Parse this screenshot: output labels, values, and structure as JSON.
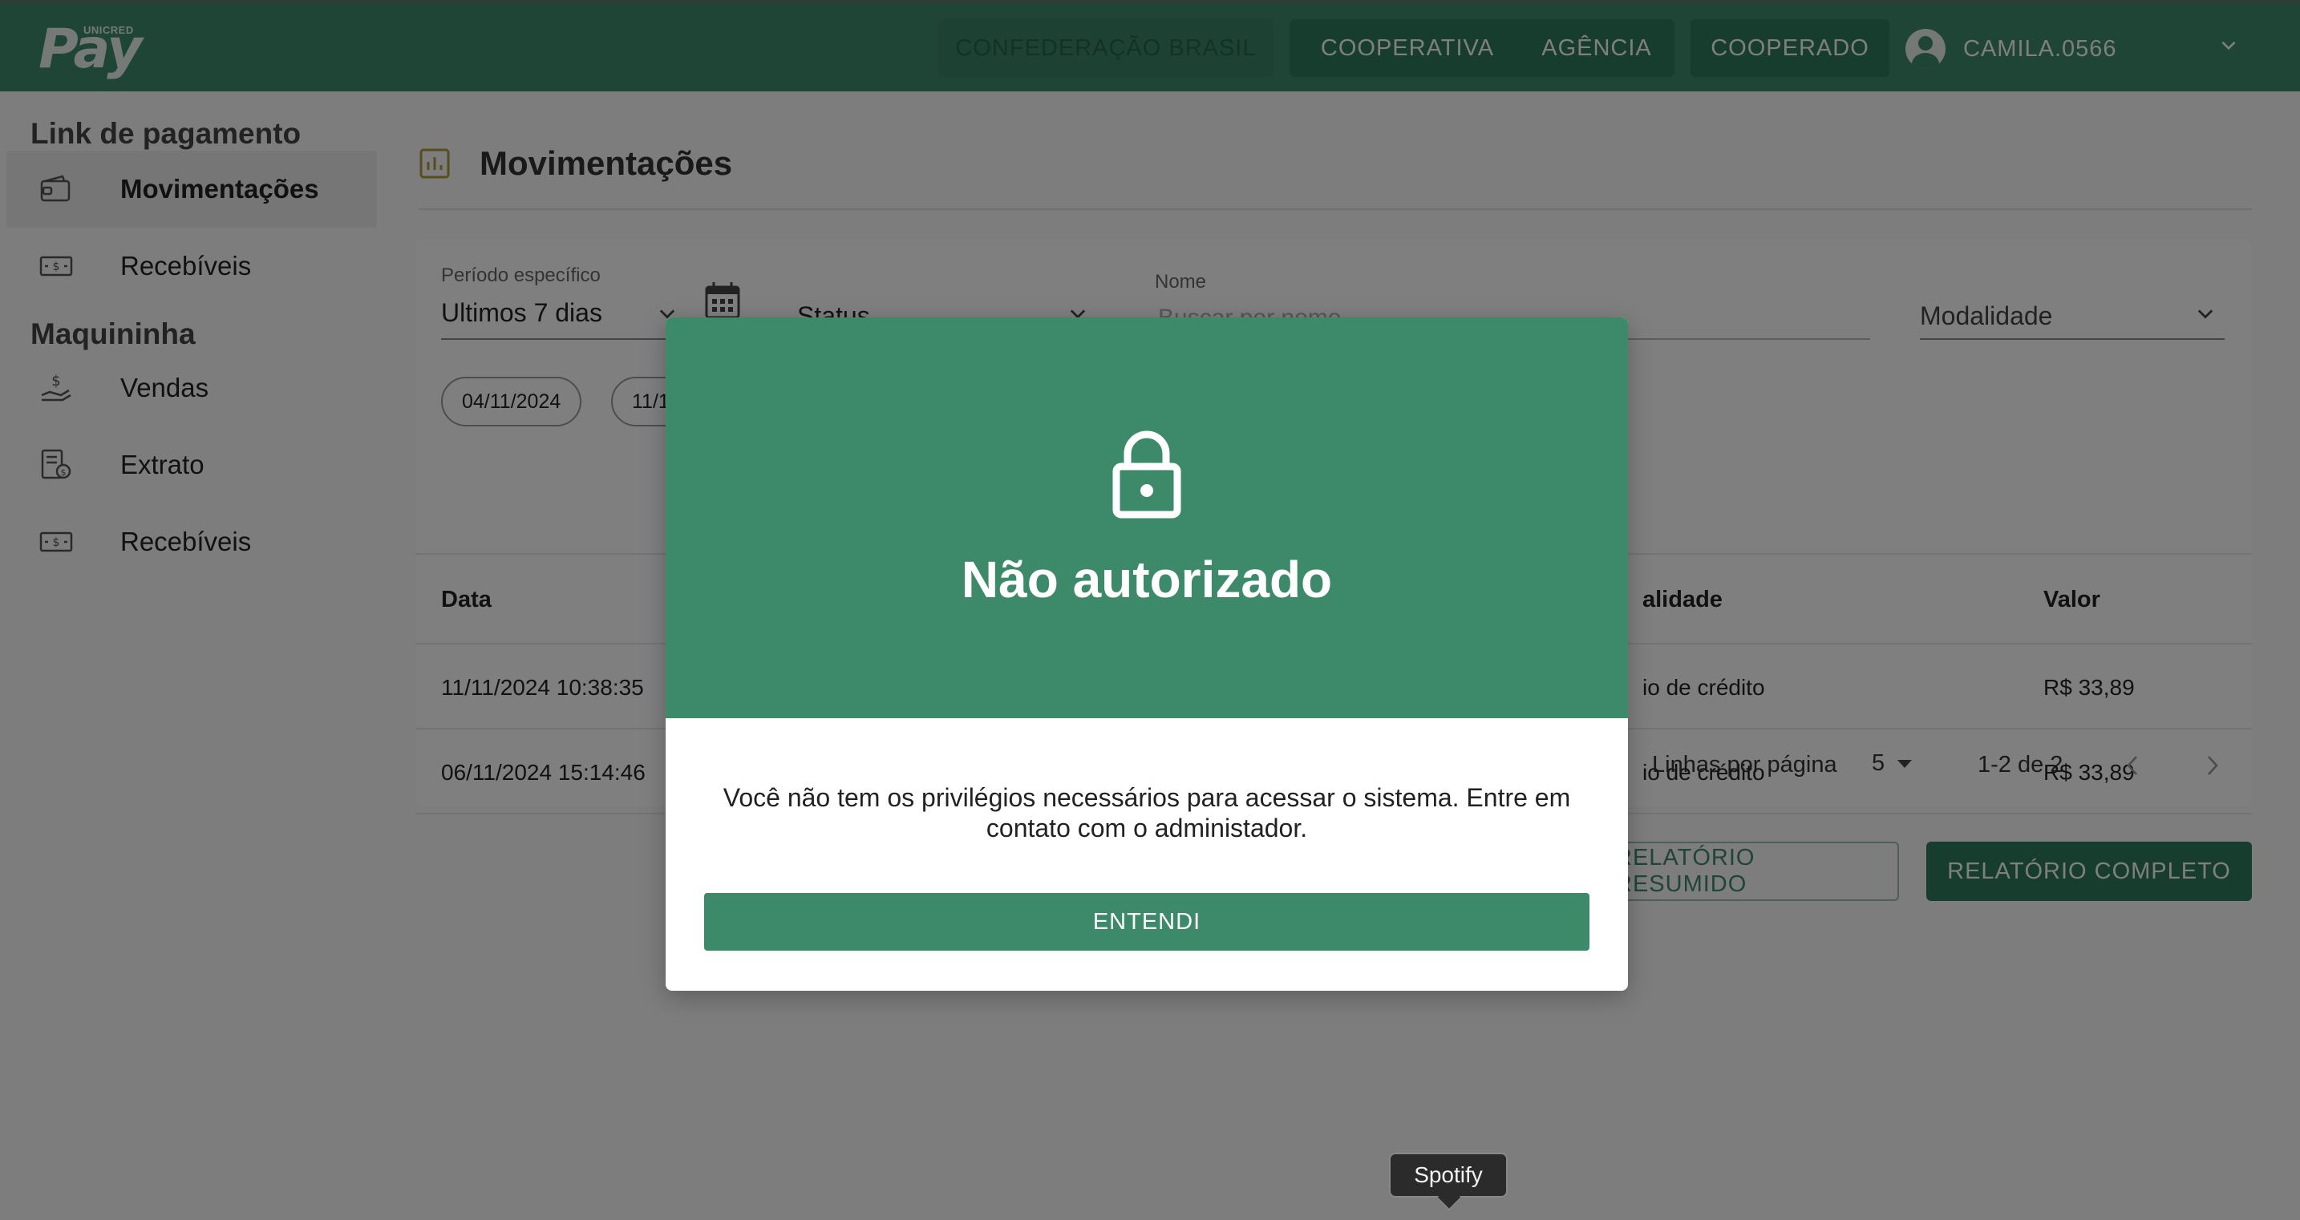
{
  "brand": {
    "logo_text": "Pay",
    "logo_small": "UNICRED"
  },
  "topbar": {
    "nav": [
      "CONFEDERAÇÃO BRASIL",
      "COOPERATIVA",
      "AGÊNCIA",
      "COOPERADO"
    ],
    "user": "CAMILA.0566"
  },
  "sidebar": {
    "section1": "Link de pagamento",
    "items1": [
      {
        "label": "Movimentações",
        "icon": "wallet-icon"
      },
      {
        "label": "Recebíveis",
        "icon": "cash-icon"
      }
    ],
    "section2": "Maquininha",
    "items2": [
      {
        "label": "Vendas",
        "icon": "hand-money-icon"
      },
      {
        "label": "Extrato",
        "icon": "receipt-icon"
      },
      {
        "label": "Recebíveis",
        "icon": "cash-icon"
      }
    ]
  },
  "main": {
    "title": "Movimentações",
    "filters": {
      "period_label": "Período específico",
      "period_value": "Ultimos 7 dias",
      "status_value": "Status",
      "name_label": "Nome",
      "name_placeholder": "Buscar por nome",
      "modality_value": "Modalidade",
      "date_from": "04/11/2024",
      "date_to": "11/1"
    },
    "table": {
      "headers": {
        "data": "Data",
        "modalidade": "alidade",
        "valor": "Valor"
      },
      "rows": [
        {
          "data": "11/11/2024 10:38:35",
          "modalidade": "io de crédito",
          "valor": "R$ 33,89"
        },
        {
          "data": "06/11/2024 15:14:46",
          "modalidade": "io de crédito",
          "valor": "R$ 33,89"
        }
      ],
      "rows_per_page_label": "Linhas por página",
      "rows_per_page": "5",
      "range": "1-2 de 2"
    },
    "buttons": {
      "summary": "RELATÓRIO RESUMIDO",
      "full": "RELATÓRIO COMPLETO"
    }
  },
  "modal": {
    "title": "Não autorizado",
    "message": "Você não tem os privilégios necessários para acessar o sistema. Entre em contato com o administador.",
    "button": "ENTENDI"
  },
  "tooltip": {
    "text": "Spotify"
  },
  "colors": {
    "primary": "#3d8a6b",
    "primary_dark": "#2f7a5c",
    "overlay": "rgba(0,0,0,0.5)"
  }
}
